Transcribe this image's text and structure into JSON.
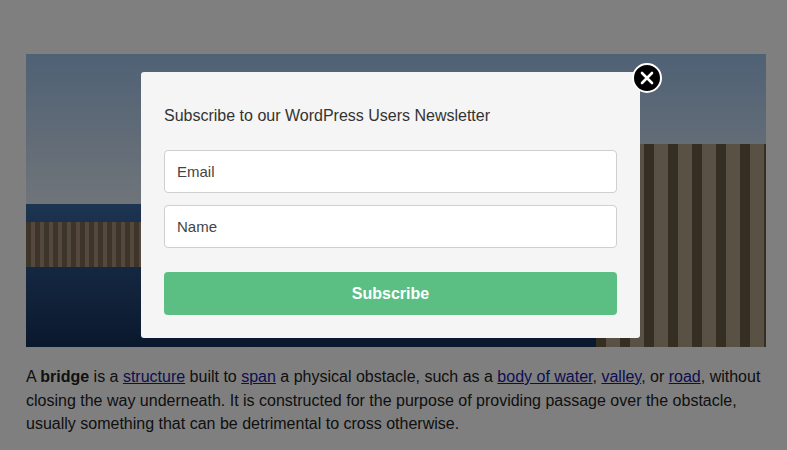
{
  "article": {
    "paragraph": [
      {
        "kind": "text",
        "text": "A "
      },
      {
        "kind": "bold",
        "text": "bridge"
      },
      {
        "kind": "text",
        "text": " is a "
      },
      {
        "kind": "link",
        "text": "structure"
      },
      {
        "kind": "text",
        "text": " built to "
      },
      {
        "kind": "link",
        "text": "span"
      },
      {
        "kind": "text",
        "text": " a physical obstacle, such as a "
      },
      {
        "kind": "link",
        "text": "body of water"
      },
      {
        "kind": "text",
        "text": ", "
      },
      {
        "kind": "link",
        "text": "valley"
      },
      {
        "kind": "text",
        "text": ", or "
      },
      {
        "kind": "link",
        "text": "road"
      },
      {
        "kind": "text",
        "text": ", without closing the way underneath. It is constructed for the purpose of providing passage over the obstacle, usually something that can be detrimental to cross otherwise."
      }
    ]
  },
  "popup": {
    "title": "Subscribe to our WordPress Users Newsletter",
    "fields": [
      {
        "placeholder": "Email"
      },
      {
        "placeholder": "Name"
      }
    ],
    "button": "Subscribe"
  }
}
